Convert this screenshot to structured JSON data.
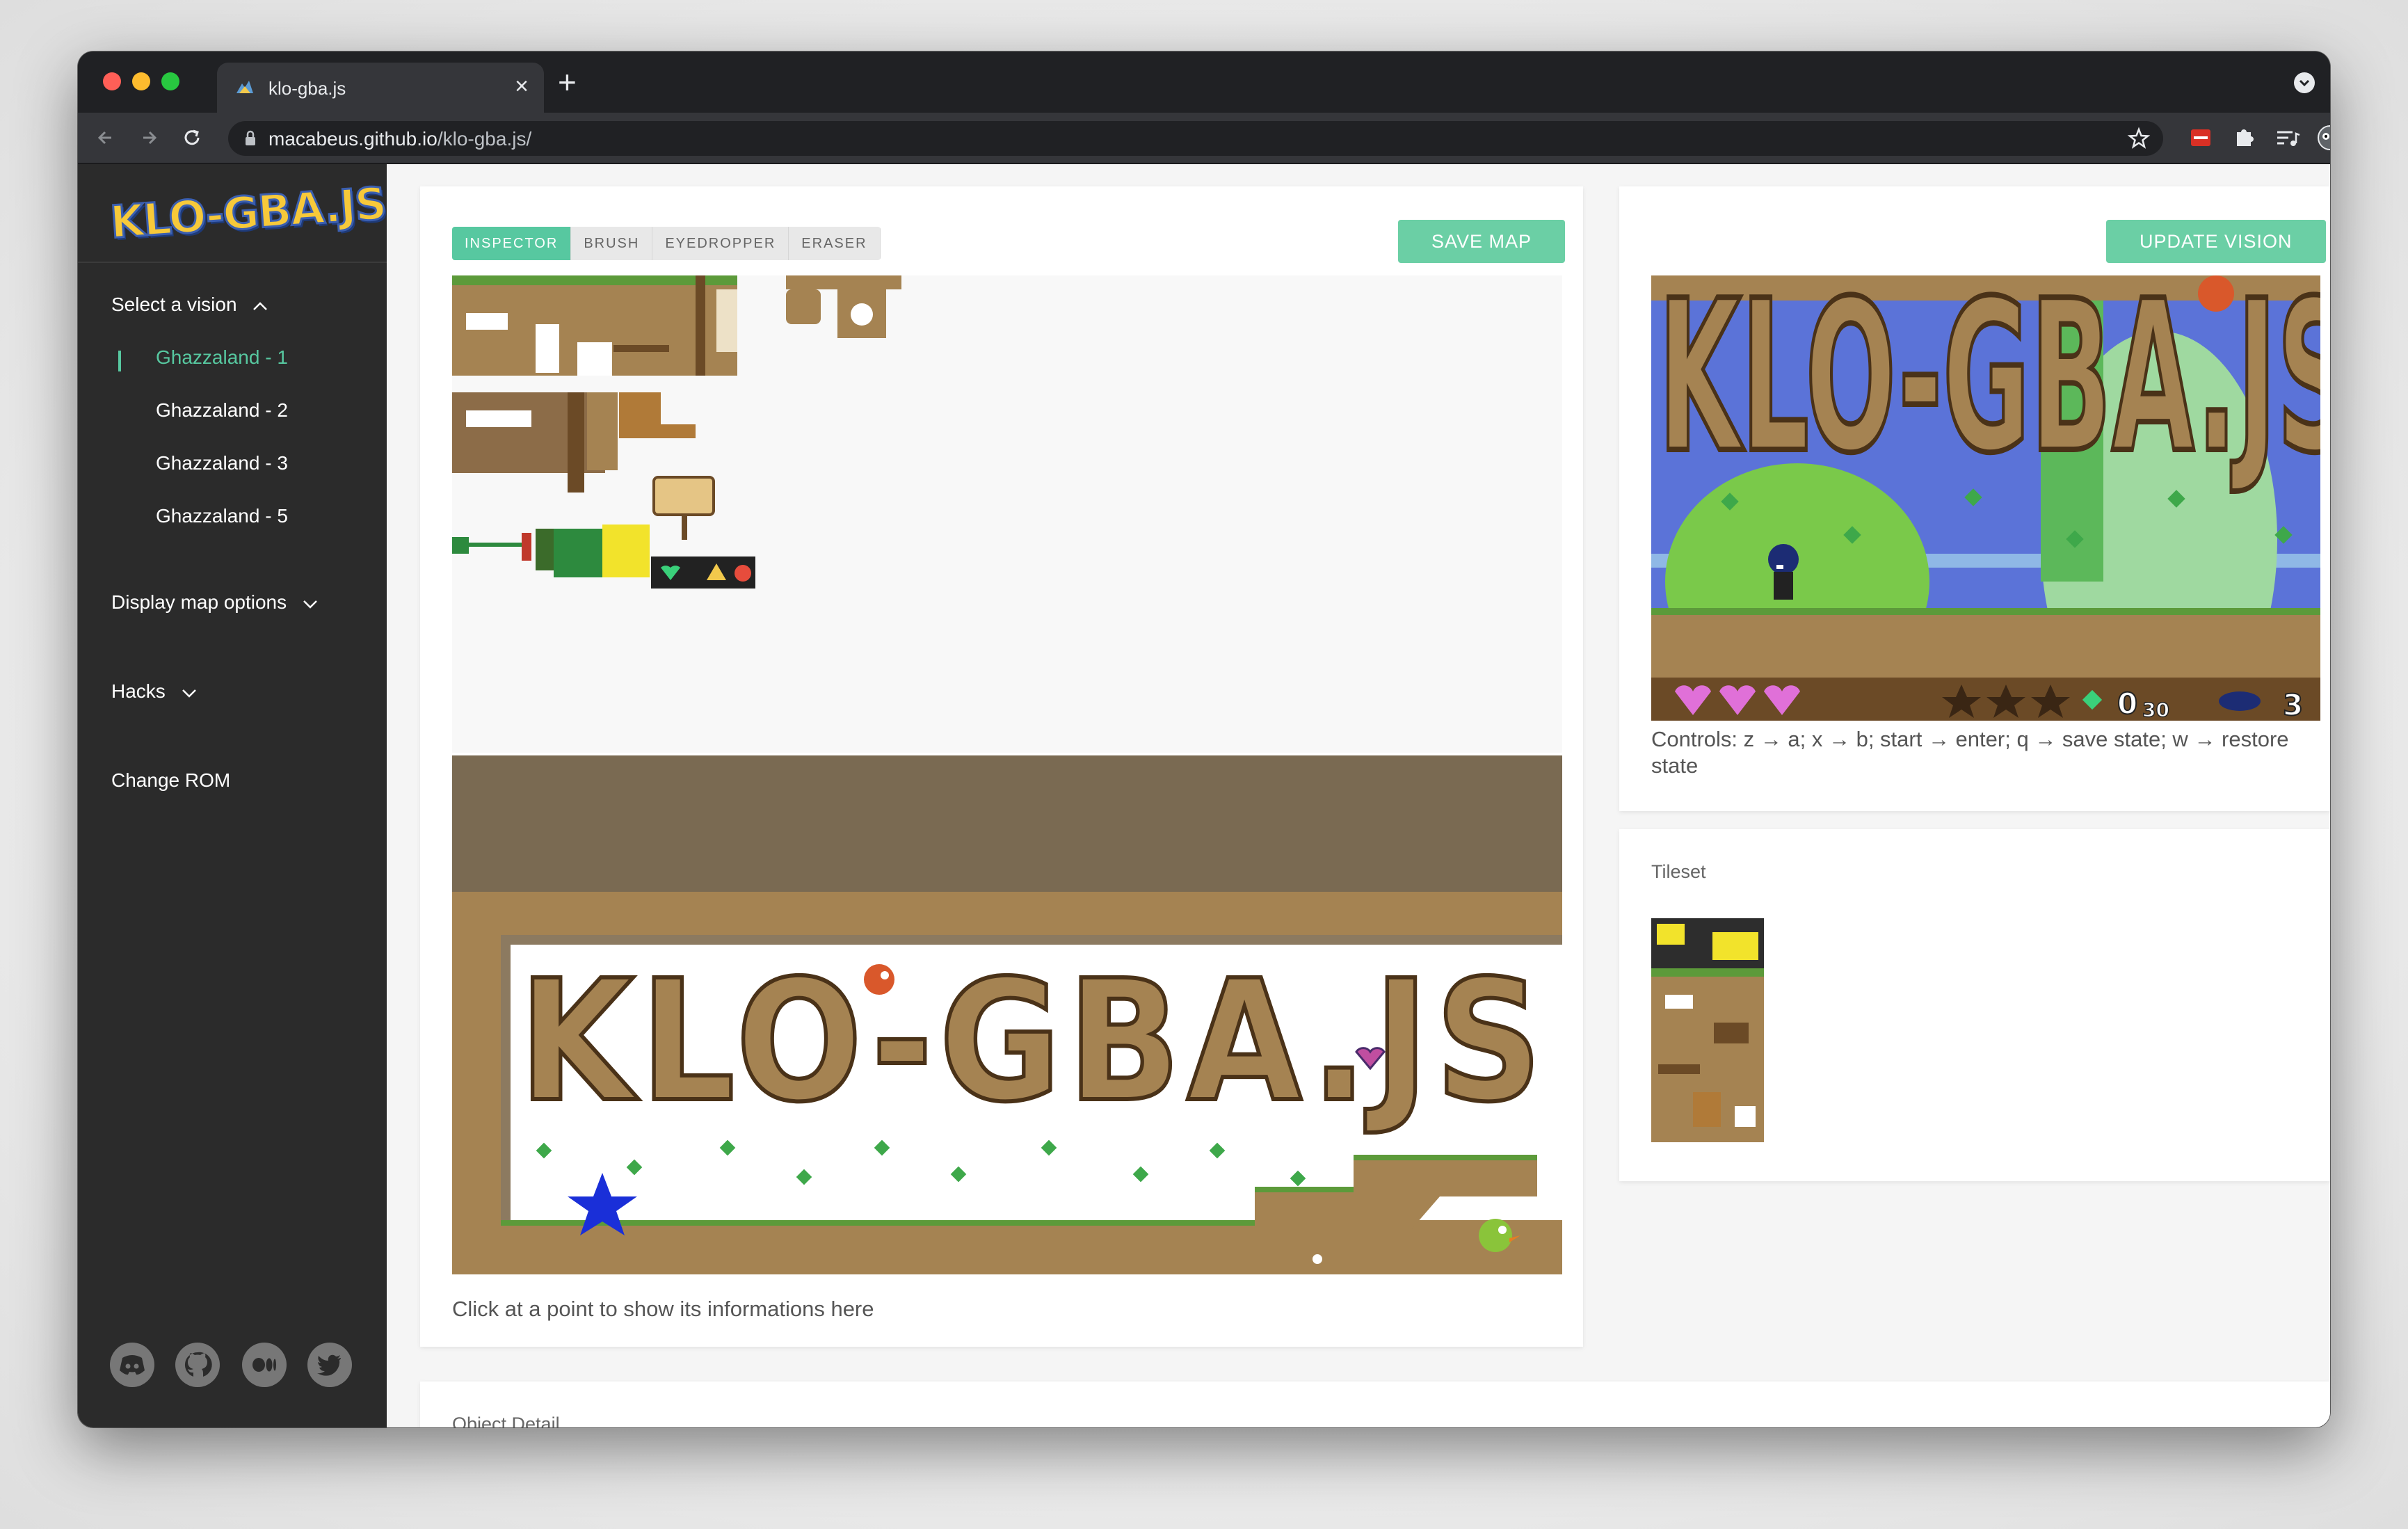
{
  "browser": {
    "tab_title": "klo-gba.js",
    "url_domain": "macabeus.github.io",
    "url_path": "/klo-gba.js/",
    "new_tab_symbol": "+",
    "close_symbol": "×"
  },
  "sidebar": {
    "logo_text": "KLO-GBA.JS",
    "vision_heading": "Select a vision",
    "visions": [
      {
        "label": "Ghazzaland - 1"
      },
      {
        "label": "Ghazzaland - 2"
      },
      {
        "label": "Ghazzaland - 3"
      },
      {
        "label": "Ghazzaland - 5"
      }
    ],
    "display_options": "Display map options",
    "hacks": "Hacks",
    "change_rom": "Change ROM",
    "social_icons": [
      "discord-icon",
      "github-icon",
      "medium-icon",
      "twitter-icon"
    ]
  },
  "editor": {
    "tools": [
      {
        "label": "INSPECTOR",
        "active": true
      },
      {
        "label": "BRUSH",
        "active": false
      },
      {
        "label": "EYEDROPPER",
        "active": false
      },
      {
        "label": "ERASER",
        "active": false
      }
    ],
    "save_button": "SAVE MAP",
    "map_title_text": "KLO-GBA.JS",
    "hint": "Click at a point to show its informations here"
  },
  "emulator": {
    "update_button": "UPDATE VISION",
    "controls_text": "Controls: z → a; x → b; start → enter; q → save state; w → restore state",
    "hud": {
      "hearts": 3,
      "stars": 3,
      "gems": "0",
      "gems_total": "30",
      "lives": "3"
    }
  },
  "tileset": {
    "label": "Tileset"
  },
  "object_detail": {
    "label": "Object Detail"
  },
  "colors": {
    "accent": "#57c8a0",
    "button": "#6bcfa5",
    "sidebar_bg": "#2b2b2b",
    "dirt": "#a58352",
    "dirt_dark": "#6b4a26",
    "grass": "#5c9a3a",
    "sky": "#5b73d8"
  }
}
